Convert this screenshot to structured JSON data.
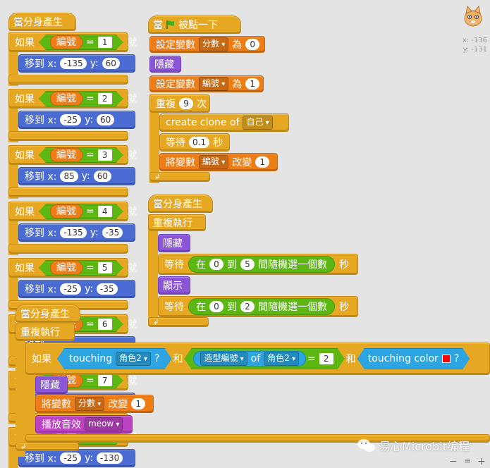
{
  "sprite_coords": {
    "x": "x: -136",
    "y": "y: -131"
  },
  "watermark": "易心Microbit编程",
  "zoom": {
    "out": "－",
    "reset": "=",
    "in": "＋"
  },
  "left_script": {
    "hat": "當分身產生",
    "if_word": "如果",
    "then_word": "就",
    "number_var": "編號",
    "eq": "=",
    "goto_label": "移到 x:",
    "y_label": "y:",
    "branches": [
      {
        "n": "1",
        "x": "-135",
        "y": "60"
      },
      {
        "n": "2",
        "x": "-25",
        "y": "60"
      },
      {
        "n": "3",
        "x": "85",
        "y": "60"
      },
      {
        "n": "4",
        "x": "-135",
        "y": "-35"
      },
      {
        "n": "5",
        "x": "-25",
        "y": "-35"
      },
      {
        "n": "6",
        "x": "",
        "y": ""
      },
      {
        "n": "7",
        "x": "",
        "y": ""
      },
      {
        "n": "",
        "x": "-25",
        "y": "-130"
      }
    ]
  },
  "flag_script": {
    "hat_pre": "當",
    "hat_post": "被點一下",
    "set1_label": "設定變數",
    "set1_var": "分數",
    "set1_to": "為",
    "set1_val": "0",
    "hide": "隱藏",
    "set2_label": "設定變數",
    "set2_var": "編號",
    "set2_to": "為",
    "set2_val": "1",
    "repeat_label": "重複",
    "repeat_n": "9",
    "repeat_unit": "次",
    "clone_label": "create clone of",
    "clone_target": "自己",
    "wait_label": "等待",
    "wait_val": "0.1",
    "wait_unit": "秒",
    "change_label": "將變數",
    "change_var": "編號",
    "change_by": "改變",
    "change_val": "1"
  },
  "clone_script": {
    "hat": "當分身產生",
    "forever": "重複執行",
    "hide": "隱藏",
    "wait": "等待",
    "rand_pre": "在",
    "rand_mid": "到",
    "rand_post": "間隨機選一個數",
    "sec": "秒",
    "rand1_from": "0",
    "rand1_to": "5",
    "show": "顯示",
    "rand2_from": "0",
    "rand2_to": "2"
  },
  "front_script": {
    "hat": "當分身產生",
    "forever": "重複執行",
    "if_word": "如果",
    "touching": "touching",
    "touch_target": "角色2",
    "q": "?",
    "and1": "和",
    "costume": "造型編號",
    "of": "of",
    "costume_target": "角色2",
    "eq": "=",
    "eq_val": "2",
    "and2": "和",
    "touch_color": "touching color",
    "color": "#ff0000",
    "hide": "隱藏",
    "change_label": "將變數",
    "change_var": "分數",
    "change_by": "改變",
    "change_val": "1",
    "sound_label": "播放音效",
    "sound_name": "meow"
  }
}
